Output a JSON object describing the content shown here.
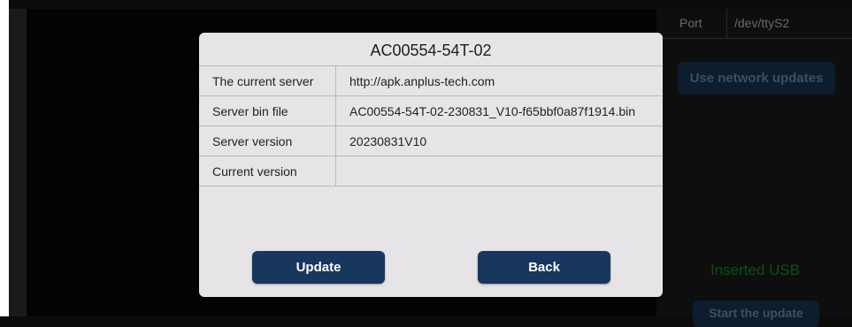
{
  "background": {
    "port_label": "Port",
    "port_value": "/dev/ttyS2",
    "network_update_button": "Use network updates",
    "usb_status": "Inserted USB",
    "start_update_button": "Start the update"
  },
  "dialog": {
    "title": "AC00554-54T-02",
    "rows": [
      {
        "label": "The current server",
        "value": "http://apk.anplus-tech.com"
      },
      {
        "label": "Server bin file",
        "value": "AC00554-54T-02-230831_V10-f65bbf0a87f1914.bin"
      },
      {
        "label": "Server version",
        "value": "20230831V10"
      },
      {
        "label": "Current version",
        "value": ""
      }
    ],
    "update_button": "Update",
    "back_button": "Back"
  },
  "colors": {
    "dialog_background": "#e6e4e7",
    "button_background": "#17375e",
    "usb_status_text": "#0f4d17"
  }
}
